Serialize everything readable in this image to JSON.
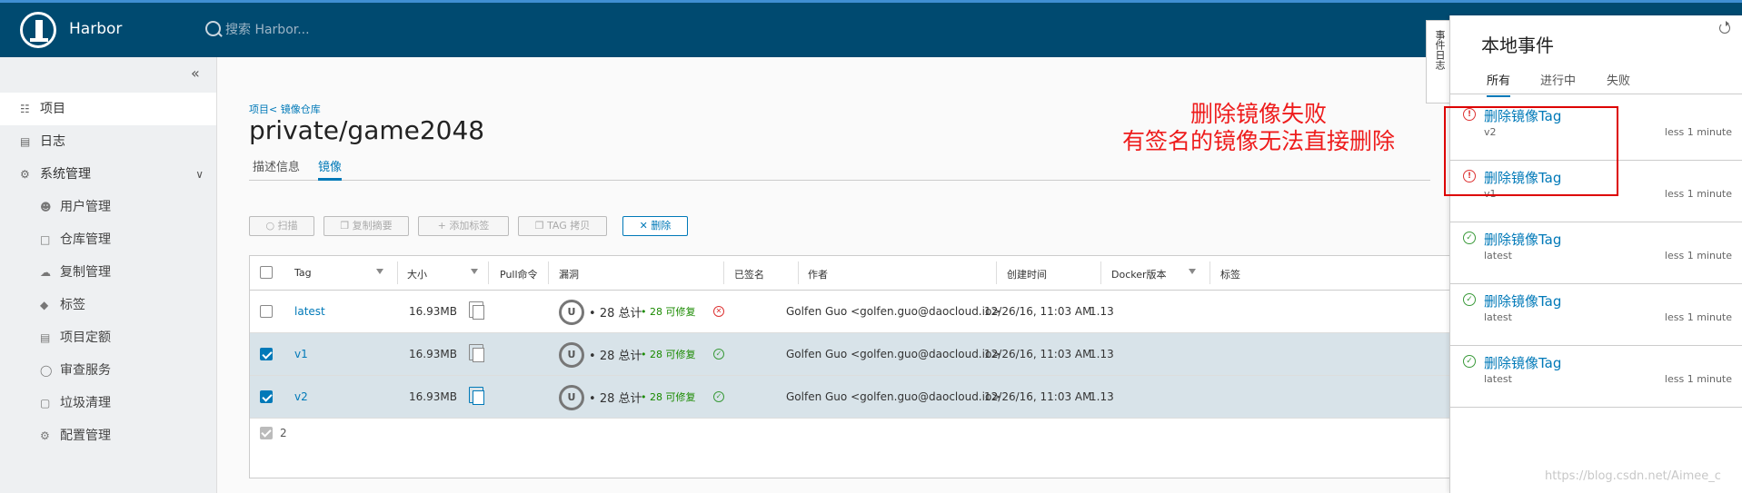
{
  "app": {
    "brand": "Harbor"
  },
  "search": {
    "placeholder": "搜索 Harbor..."
  },
  "sidebar": {
    "collapse": "«",
    "items": [
      {
        "label": "项目",
        "icon": "project-icon"
      },
      {
        "label": "日志",
        "icon": "log-icon"
      },
      {
        "label": "系统管理",
        "icon": "admin-icon"
      }
    ],
    "subitems": [
      {
        "label": "用户管理",
        "icon": "users-icon"
      },
      {
        "label": "仓库管理",
        "icon": "registry-icon"
      },
      {
        "label": "复制管理",
        "icon": "replication-icon"
      },
      {
        "label": "标签",
        "icon": "tag-icon"
      },
      {
        "label": "项目定额",
        "icon": "quota-icon"
      },
      {
        "label": "审查服务",
        "icon": "shield-icon"
      },
      {
        "label": "垃圾清理",
        "icon": "trash-icon"
      },
      {
        "label": "配置管理",
        "icon": "gear-icon"
      }
    ]
  },
  "main": {
    "breadcrumb": "项目< 镜像仓库",
    "title": "private/game2048",
    "tabs": [
      "描述信息",
      "镜像"
    ]
  },
  "toolbar": {
    "scan": "扫描",
    "copy_digest": "复制摘要",
    "add_label": "添加标签",
    "tag_copy": "TAG 拷贝",
    "delete": "删除"
  },
  "table": {
    "headers": {
      "tag": "Tag",
      "size": "大小",
      "pull": "Pull命令",
      "vuln": "漏洞",
      "signed": "已签名",
      "author": "作者",
      "created": "创建时间",
      "docker": "Docker版本",
      "labels": "标签"
    },
    "rows": [
      {
        "tag": "latest",
        "size": "16.93MB",
        "vuln_badge": "U",
        "total": "28 总计",
        "fixable": "28 可修复",
        "signed": false,
        "author": "Golfen Guo <golfen.guo@daocloud.io>",
        "created": "12/26/16, 11:03 AM",
        "docker": "1.13",
        "selected": false
      },
      {
        "tag": "v1",
        "size": "16.93MB",
        "vuln_badge": "U",
        "total": "28 总计",
        "fixable": "28 可修复",
        "signed": true,
        "author": "Golfen Guo <golfen.guo@daocloud.io>",
        "created": "12/26/16, 11:03 AM",
        "docker": "1.13",
        "selected": true
      },
      {
        "tag": "v2",
        "size": "16.93MB",
        "vuln_badge": "U",
        "total": "28 总计",
        "fixable": "28 可修复",
        "signed": true,
        "author": "Golfen Guo <golfen.guo@daocloud.io>",
        "created": "12/26/16, 11:03 AM",
        "docker": "1.13",
        "selected": true
      }
    ],
    "footer_count": "2"
  },
  "events_tab": "事件日志",
  "panel": {
    "title": "本地事件",
    "tabs": [
      "所有",
      "进行中",
      "失败"
    ],
    "events": [
      {
        "title": "删除镜像Tag",
        "sub": "v2",
        "time": "less 1 minute",
        "status": "fail"
      },
      {
        "title": "删除镜像Tag",
        "sub": "v1",
        "time": "less 1 minute",
        "status": "fail"
      },
      {
        "title": "删除镜像Tag",
        "sub": "latest",
        "time": "less 1 minute",
        "status": "ok"
      },
      {
        "title": "删除镜像Tag",
        "sub": "latest",
        "time": "less 1 minute",
        "status": "ok"
      },
      {
        "title": "删除镜像Tag",
        "sub": "latest",
        "time": "less 1 minute",
        "status": "ok"
      }
    ]
  },
  "annotation": {
    "line1": "删除镜像失败",
    "line2": "有签名的镜像无法直接删除"
  },
  "watermark": "https://blog.csdn.net/Aimee_c",
  "colors": {
    "header": "#004a70",
    "accent": "#0079b8",
    "annotation": "#ee1c1c",
    "success": "#3a9a3a",
    "danger": "#d33333"
  }
}
